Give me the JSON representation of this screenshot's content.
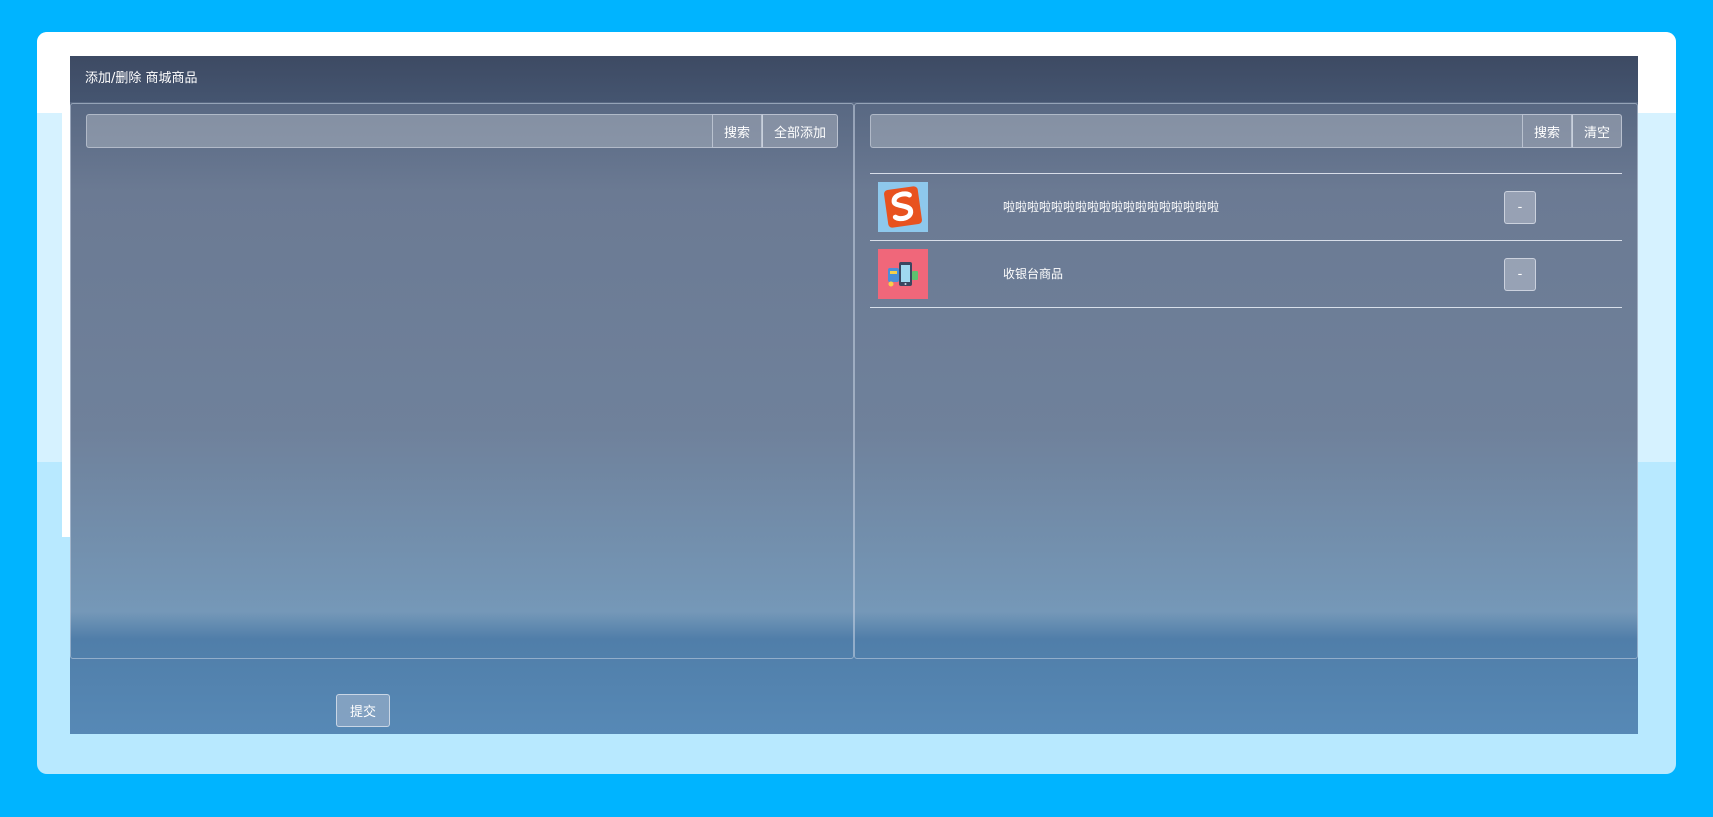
{
  "modal": {
    "title": "添加/删除 商城商品"
  },
  "left_panel": {
    "search_placeholder": "",
    "search_value": "",
    "search_label": "搜索",
    "add_all_label": "全部添加"
  },
  "right_panel": {
    "search_placeholder": "",
    "search_value": "",
    "search_label": "搜索",
    "clear_label": "清空",
    "products": [
      {
        "name": "啦啦啦啦啦啦啦啦啦啦啦啦啦啦啦啦啦啦",
        "icon": "sogou-s-logo-icon",
        "remove_label": "-"
      },
      {
        "name": "收银台商品",
        "icon": "cashier-phone-icon",
        "remove_label": "-"
      }
    ]
  },
  "footer": {
    "submit_label": "提交"
  },
  "colors": {
    "page_background": "#00b4ff",
    "header_background": "#3d4a63",
    "product1_thumb_background": "#8ec8ec",
    "product1_logo_color": "#e8521f",
    "product2_thumb_background": "#f0677a"
  }
}
